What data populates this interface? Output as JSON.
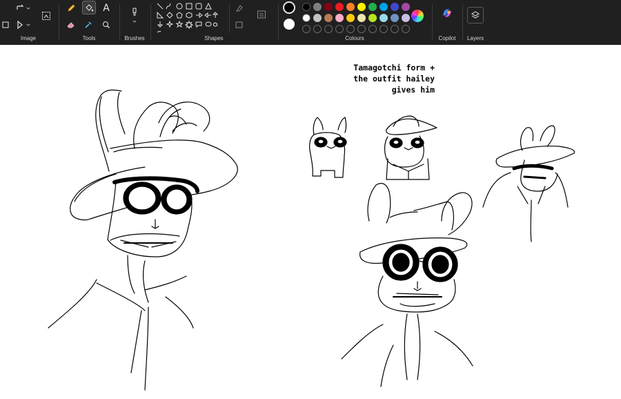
{
  "toolbar": {
    "groups": {
      "image": "Image",
      "tools": "Tools",
      "brushes": "Brushes",
      "shapes": "Shapes",
      "colours": "Colours",
      "copilot": "Copilot",
      "layers": "Layers"
    },
    "active_colour_primary": "#000000",
    "active_colour_secondary": "#ffffff",
    "palette_row1": [
      "#000000",
      "#7f7f7f",
      "#880015",
      "#ed1c24",
      "#ff7f27",
      "#fff200",
      "#22b14c",
      "#00a2e8",
      "#3f48cc",
      "#a349a4"
    ],
    "palette_row2": [
      "#ffffff",
      "#c3c3c3",
      "#b97a57",
      "#ffaec9",
      "#ffc90e",
      "#efe4b0",
      "#b5e61d",
      "#99d9ea",
      "#7092be",
      "#c8bfe7"
    ],
    "text_tool_glyph": "A"
  },
  "canvas": {
    "note_lines": [
      "Tamagotchi form +",
      "the outfit hailey",
      "gives him"
    ]
  }
}
